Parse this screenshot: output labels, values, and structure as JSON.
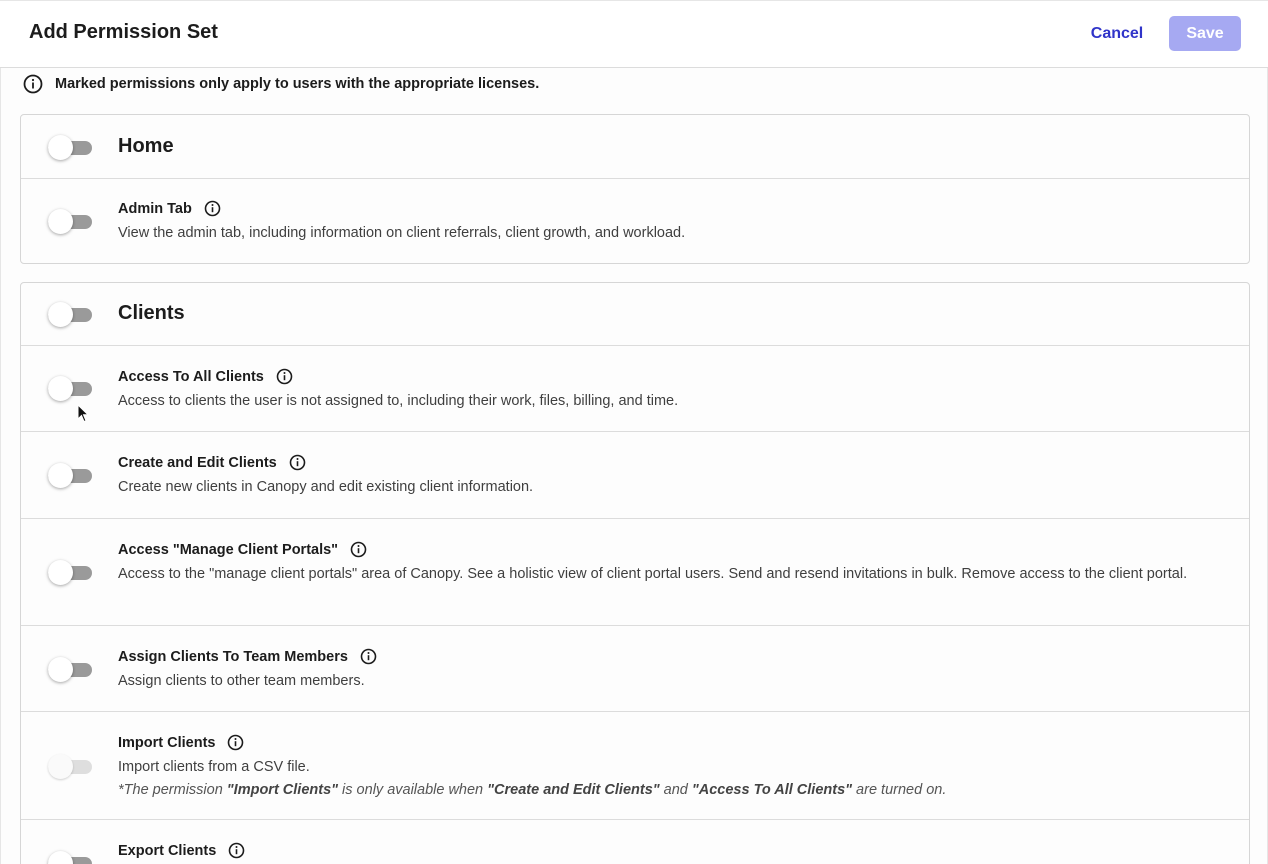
{
  "header": {
    "title": "Add Permission Set",
    "cancel_label": "Cancel",
    "save_label": "Save"
  },
  "notice": {
    "text": "Marked permissions only apply to users with the appropriate licenses."
  },
  "sections": [
    {
      "title": "Home",
      "enabled": false,
      "permissions": [
        {
          "title": "Admin Tab",
          "description": "View the admin tab, including information on client referrals, client growth, and workload.",
          "enabled": false
        }
      ]
    },
    {
      "title": "Clients",
      "enabled": false,
      "permissions": [
        {
          "title": "Access To All Clients",
          "description": "Access to clients the user is not assigned to, including their work, files, billing, and time.",
          "enabled": false
        },
        {
          "title": "Create and Edit Clients",
          "description": "Create new clients in Canopy and edit existing client information.",
          "enabled": false
        },
        {
          "title": "Access \"Manage Client Portals\"",
          "description": "Access to the \"manage client portals\" area of Canopy. See a holistic view of client portal users. Send and resend invitations in bulk. Remove access to the client portal.",
          "enabled": false
        },
        {
          "title": "Assign Clients To Team Members",
          "description": "Assign clients to other team members.",
          "enabled": false
        },
        {
          "title": "Import Clients",
          "description": "Import clients from a CSV file.",
          "enabled": false,
          "disabled": true,
          "note": {
            "prefix": "*The permission ",
            "perm": "\"Import Clients\"",
            "mid": " is only available when ",
            "req1": "\"Create and Edit Clients\"",
            "and": " and ",
            "req2": "\"Access To All Clients\"",
            "suffix": " are turned on."
          }
        },
        {
          "title": "Export Clients",
          "description": "",
          "enabled": false
        }
      ]
    }
  ],
  "colors": {
    "accent": "#3034c9",
    "save_disabled": "#a6a9f2",
    "toggle_off_track": "#9a9a9a"
  },
  "icons": {
    "info": "info-circle-icon",
    "cursor": "mouse-pointer-icon"
  }
}
